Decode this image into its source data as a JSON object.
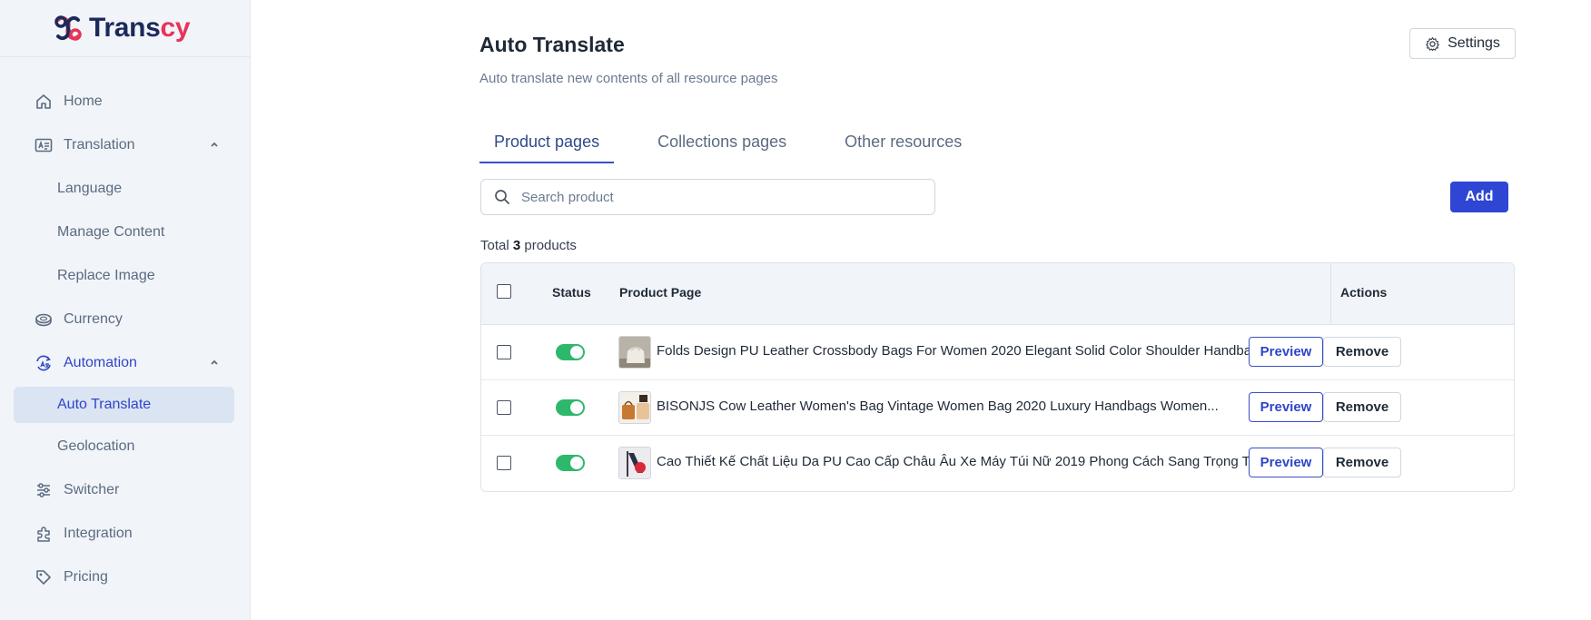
{
  "brand": {
    "name_main": "Trans",
    "name_accent": "cy",
    "accent_color": "#e8335a",
    "primary_color": "#2f45d4"
  },
  "sidebar": {
    "items": [
      {
        "label": "Home",
        "icon": "home-icon"
      },
      {
        "label": "Translation",
        "icon": "translation-icon",
        "expanded": true
      },
      {
        "label": "Language"
      },
      {
        "label": "Manage Content"
      },
      {
        "label": "Replace Image"
      },
      {
        "label": "Currency",
        "icon": "currency-icon"
      },
      {
        "label": "Automation",
        "icon": "automation-icon",
        "expanded": true
      },
      {
        "label": "Auto Translate",
        "active": true
      },
      {
        "label": "Geolocation"
      },
      {
        "label": "Switcher",
        "icon": "switcher-icon"
      },
      {
        "label": "Integration",
        "icon": "integration-icon"
      },
      {
        "label": "Pricing",
        "icon": "pricing-icon"
      }
    ]
  },
  "header": {
    "title": "Auto Translate",
    "subtitle": "Auto translate new contents of all resource pages",
    "settings_label": "Settings"
  },
  "tabs": [
    {
      "label": "Product pages",
      "active": true
    },
    {
      "label": "Collections pages"
    },
    {
      "label": "Other resources"
    }
  ],
  "search": {
    "placeholder": "Search product",
    "value": ""
  },
  "add_label": "Add",
  "total": {
    "prefix": "Total",
    "count": "3",
    "suffix": "products"
  },
  "table": {
    "columns": {
      "status": "Status",
      "page": "Product Page",
      "actions": "Actions"
    },
    "rows": [
      {
        "name": "Folds Design PU Leather Crossbody Bags For Women 2020 Elegant Solid Color Shoulder Handbag...",
        "status_on": true,
        "preview": "Preview",
        "remove": "Remove"
      },
      {
        "name": "BISONJS Cow Leather Women's Bag Vintage Women Bag 2020 Luxury Handbags Women...",
        "status_on": true,
        "preview": "Preview",
        "remove": "Remove"
      },
      {
        "name": "Cao Thiết Kế Chất Liệu Da PU Cao Cấp Châu Âu Xe Máy Túi Nữ 2019 Phong Cách Sang Trọng Tua...",
        "status_on": true,
        "preview": "Preview",
        "remove": "Remove"
      }
    ]
  }
}
